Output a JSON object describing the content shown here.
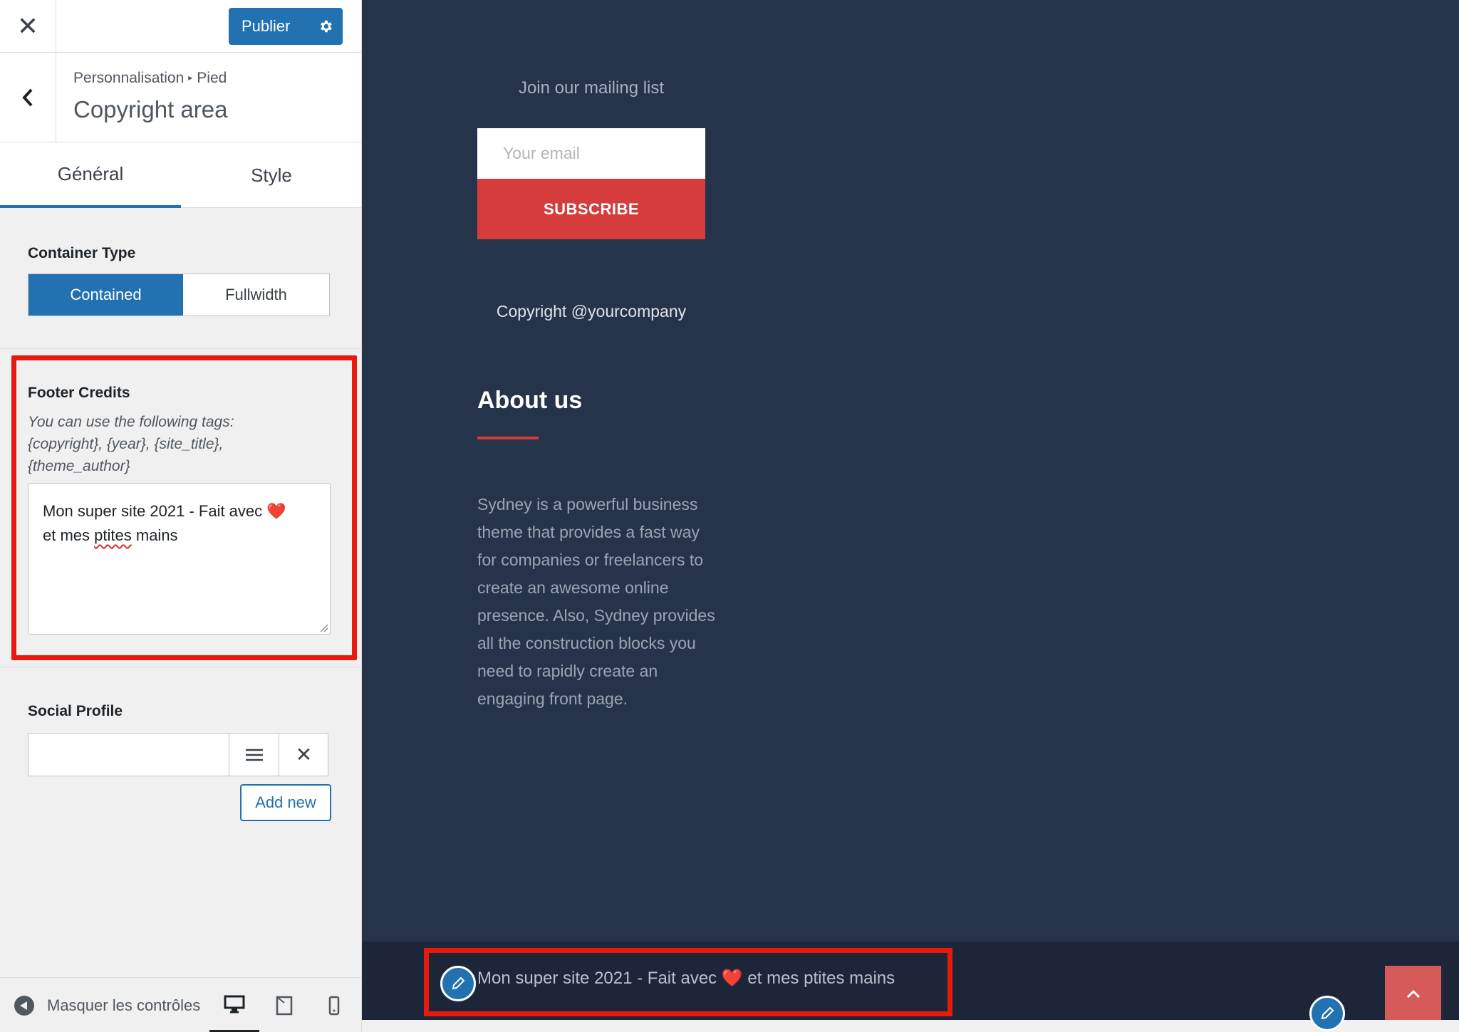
{
  "topbar": {
    "close_symbol": "✕",
    "publish_label": "Publier"
  },
  "section": {
    "breadcrumb_parent": "Personnalisation",
    "breadcrumb_separator": "▸",
    "breadcrumb_child": "Pied",
    "title": "Copyright area"
  },
  "tabs": [
    {
      "label": "Général",
      "active": true
    },
    {
      "label": "Style",
      "active": false
    }
  ],
  "container_type": {
    "label": "Container Type",
    "options": [
      "Contained",
      "Fullwidth"
    ],
    "selected": "Contained"
  },
  "footer_credits": {
    "label": "Footer Credits",
    "help_line1": "You can use the following tags:",
    "help_line2": "{copyright}, {year}, {site_title},",
    "help_line3": "{theme_author}",
    "value_part1": "Mon super site 2021 - Fait avec",
    "heart": "❤️",
    "value_part2": "et mes",
    "value_misspelled": "ptites",
    "value_part3": "mains"
  },
  "social_profile": {
    "label": "Social Profile",
    "remove_symbol": "✕",
    "add_new_label": "Add new"
  },
  "bottombar": {
    "hide_controls_label": "Masquer les contrôles"
  },
  "preview": {
    "mailing_title": "Join our mailing list",
    "email_placeholder": "Your email",
    "subscribe_label": "SUBSCRIBE",
    "copyright": "Copyright @yourcompany",
    "about_title": "About us",
    "about_text": "Sydney is a powerful business theme that provides a fast way for companies or freelancers to create an awesome online presence. Also, Sydney provides all the construction blocks you need to rapidly create an engaging front page.",
    "footer_credits_part1": "Mon super site 2021 - Fait avec",
    "footer_credits_heart": "❤️",
    "footer_credits_part2": "et mes ptites mains"
  },
  "colors": {
    "accent_blue": "#2271b1",
    "highlight_red": "#e8190e",
    "preview_bg": "#26344b",
    "subscribe_red": "#d63c3c"
  },
  "icons": [
    "close-icon",
    "gear-icon",
    "chevron-left-icon",
    "hamburger-icon",
    "remove-icon",
    "collapse-icon",
    "desktop-icon",
    "tablet-icon",
    "mobile-icon",
    "pencil-icon",
    "chevron-up-icon"
  ]
}
